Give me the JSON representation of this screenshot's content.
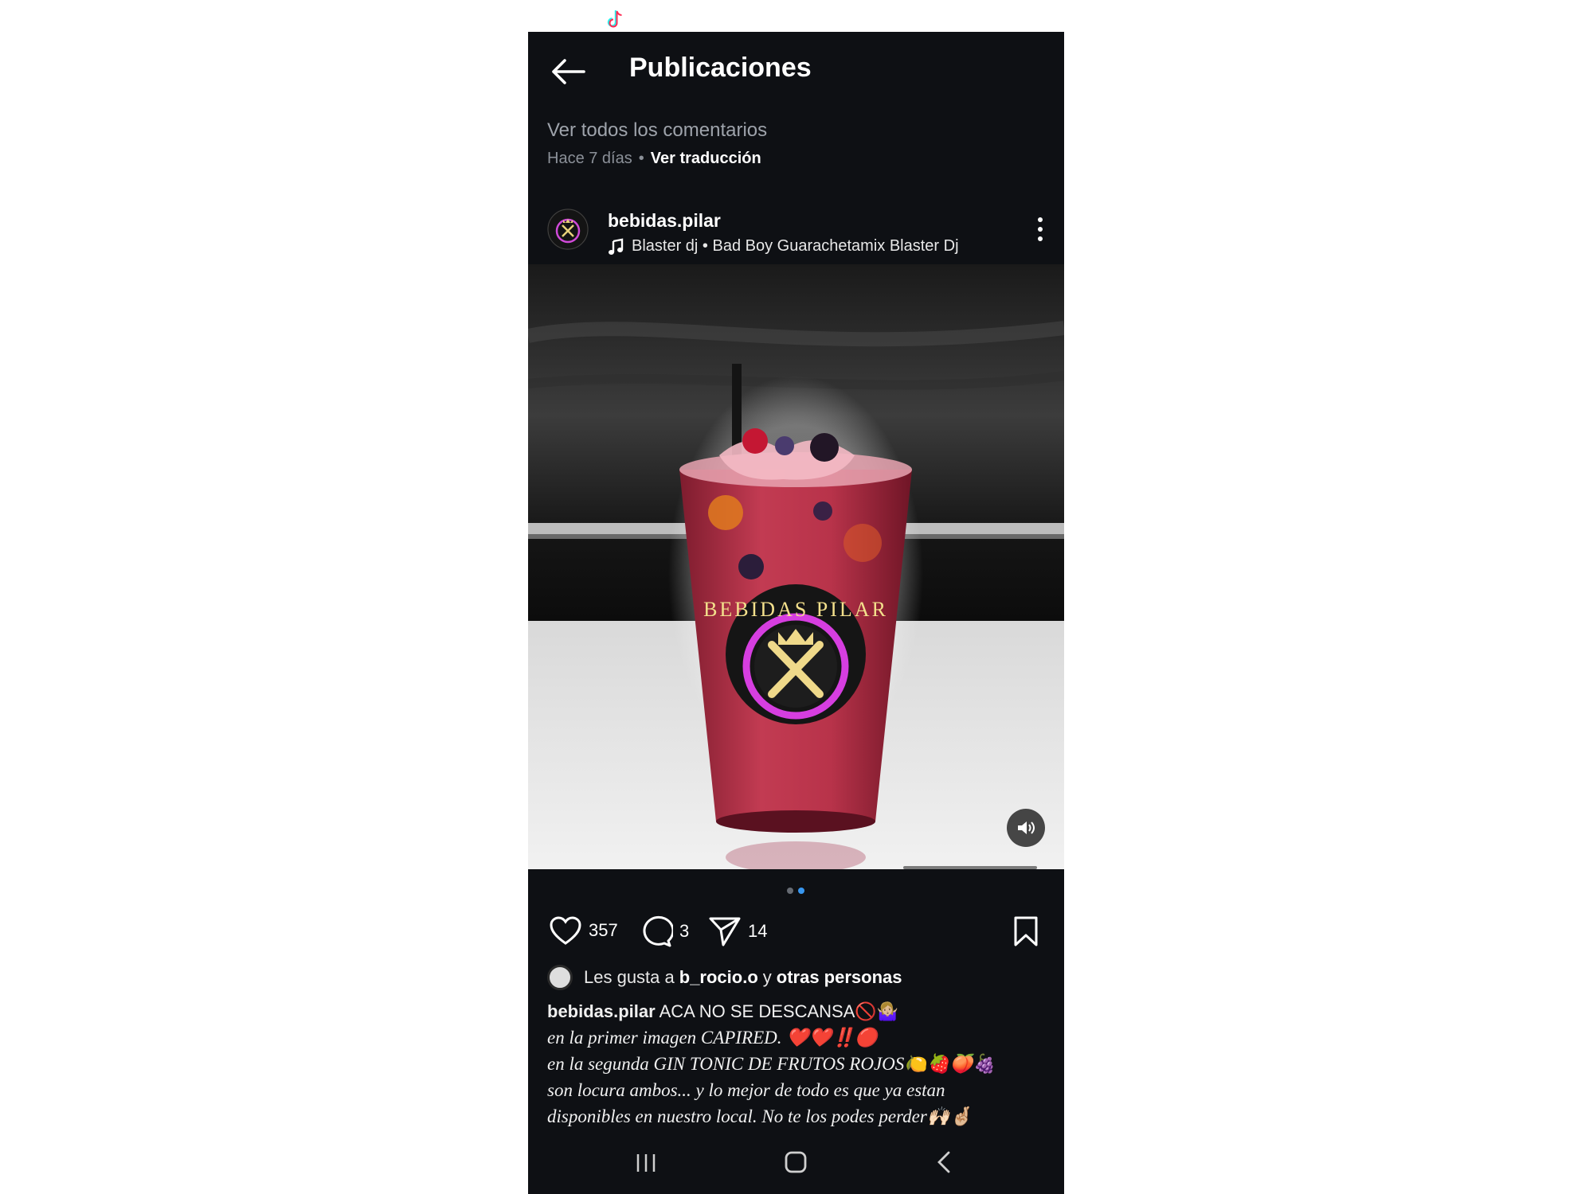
{
  "header": {
    "title": "Publicaciones"
  },
  "comments": {
    "view_all": "Ver todos los comentarios",
    "time_ago": "Hace 7 días",
    "separator": "•",
    "translate": "Ver traducción"
  },
  "post": {
    "username": "bebidas.pilar",
    "audio": "Blaster dj • Bad Boy Guarachetamix Blaster Dj",
    "image_logo_text": "BEBIDAS PILAR",
    "carousel": {
      "total": 2,
      "active": 2
    },
    "counts": {
      "likes": "357",
      "comments": "3",
      "shares": "14"
    },
    "likes_line": {
      "prefix": "Les gusta a",
      "user": "b_rocio.o",
      "connector": "y",
      "others": "otras personas"
    },
    "caption": {
      "user": "bebidas.pilar",
      "headline": "ACA NO SE DESCANSA🚫🤷🏼‍♀️",
      "line1": "en la primer imagen CAPIRED. ❤️❤️‼️🔴",
      "line2": "en la segunda GIN TONIC DE FRUTOS ROJOS🍋🍓🍑🍇",
      "line3": "son locura ambos... y lo mejor de todo es que ya estan",
      "line4": "disponibles en nuestro local. No te los podes perder🙌🏻🤞🏼"
    }
  },
  "colors": {
    "background": "#0e1014",
    "accent_dot": "#3897f0",
    "muted_text": "#9ea3ab"
  },
  "icons": {
    "back": "arrow-left-icon",
    "music": "music-note-icon",
    "more": "more-vertical-icon",
    "volume": "volume-icon",
    "like": "heart-icon",
    "comment": "comment-icon",
    "share": "send-icon",
    "save": "bookmark-icon",
    "nav_recents": "recents-icon",
    "nav_home": "home-icon",
    "nav_back": "nav-back-icon",
    "tiktok": "tiktok-icon"
  }
}
